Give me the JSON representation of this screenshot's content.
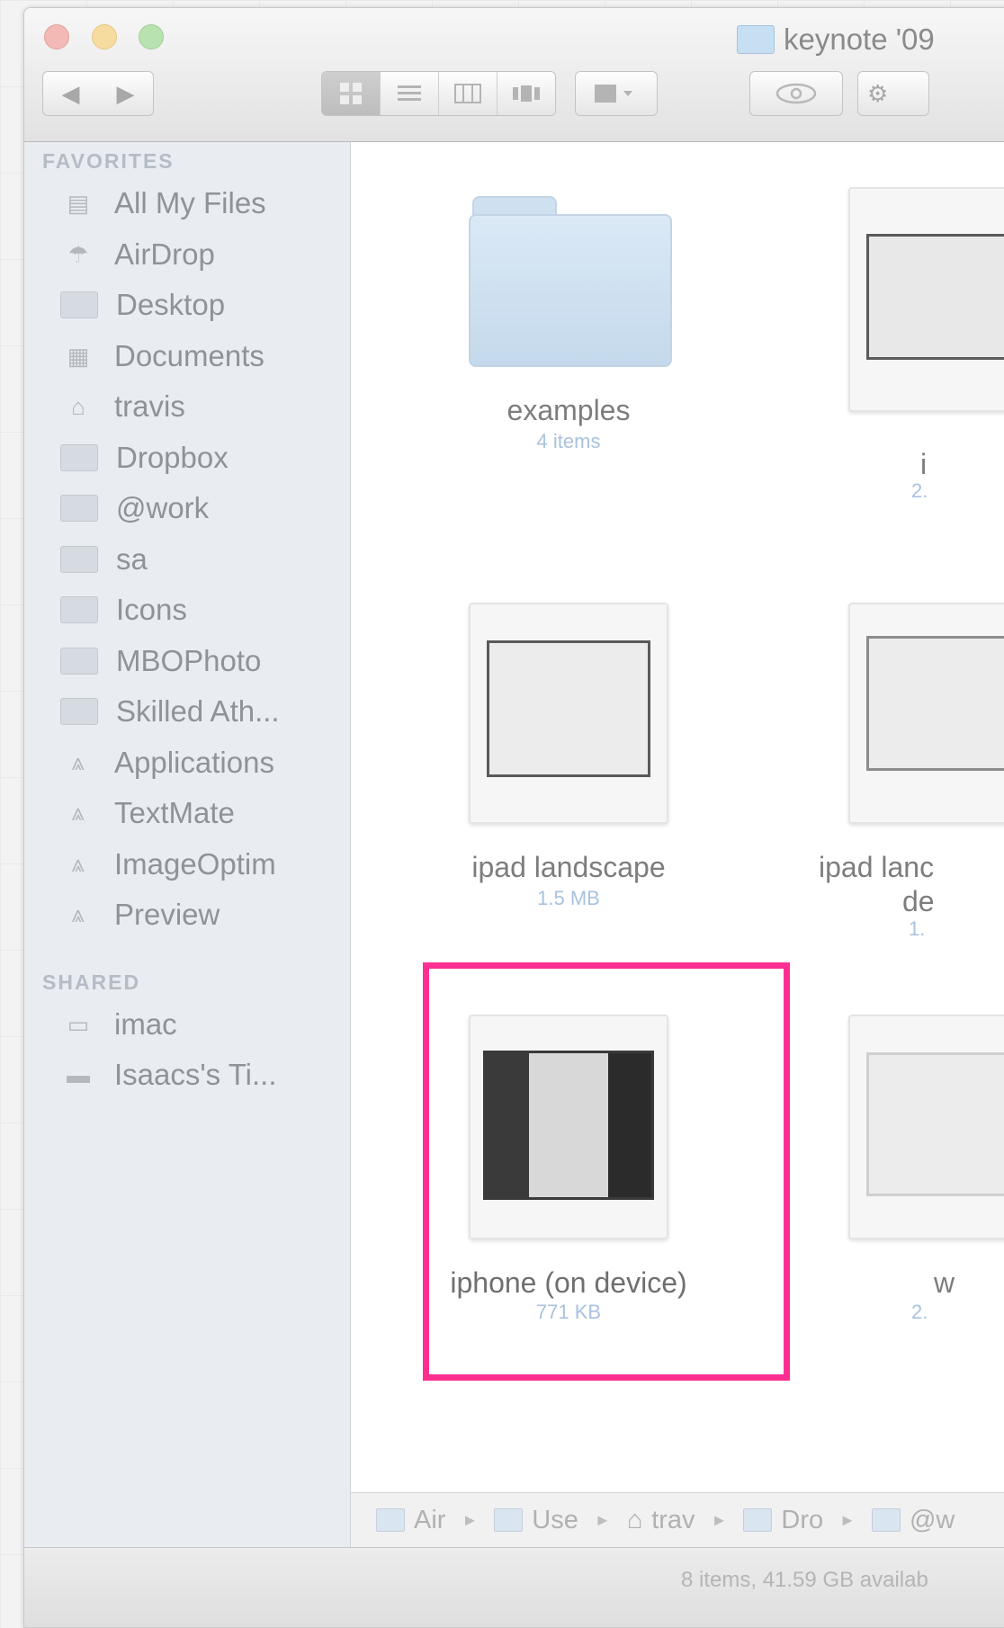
{
  "window": {
    "title": "keynote '09"
  },
  "toolbar": {
    "back": "◀",
    "forward": "▶",
    "views": [
      "icon-view",
      "list-view",
      "column-view",
      "coverflow-view"
    ],
    "arrange": "arrange-menu",
    "quicklook": "quicklook",
    "action": "action-menu"
  },
  "sidebar": {
    "favorites_heading": "FAVORITES",
    "favorites": [
      {
        "label": "All My Files",
        "icon": "all-files-icon"
      },
      {
        "label": "AirDrop",
        "icon": "airdrop-icon"
      },
      {
        "label": "Desktop",
        "icon": "desktop-icon"
      },
      {
        "label": "Documents",
        "icon": "documents-icon"
      },
      {
        "label": "travis",
        "icon": "home-icon"
      },
      {
        "label": "Dropbox",
        "icon": "folder-icon"
      },
      {
        "label": "@work",
        "icon": "folder-icon"
      },
      {
        "label": "sa",
        "icon": "folder-icon"
      },
      {
        "label": "Icons",
        "icon": "folder-icon"
      },
      {
        "label": "MBOPhoto",
        "icon": "folder-icon"
      },
      {
        "label": "Skilled Ath...",
        "icon": "folder-icon"
      },
      {
        "label": "Applications",
        "icon": "applications-icon"
      },
      {
        "label": "TextMate",
        "icon": "applications-icon"
      },
      {
        "label": "ImageOptim",
        "icon": "applications-icon"
      },
      {
        "label": "Preview",
        "icon": "applications-icon"
      }
    ],
    "shared_heading": "SHARED",
    "shared": [
      {
        "label": "imac",
        "icon": "display-icon"
      },
      {
        "label": "Isaacs's Ti...",
        "icon": "server-icon"
      }
    ]
  },
  "files": [
    {
      "name": "examples",
      "sub": "4 items",
      "kind": "folder"
    },
    {
      "name": "i",
      "sub": "2.",
      "kind": "keynote"
    },
    {
      "name": "ipad landscape",
      "sub": "1.5 MB",
      "kind": "keynote"
    },
    {
      "name": "ipad lanc",
      "name2": "de",
      "sub": "1.",
      "kind": "keynote"
    },
    {
      "name": "iphone (on device)",
      "sub": "771 KB",
      "kind": "keynote"
    },
    {
      "name": "w",
      "sub": "2.",
      "kind": "keynote"
    }
  ],
  "pathbar": [
    {
      "label": "Air"
    },
    {
      "label": "Use"
    },
    {
      "label": "trav"
    },
    {
      "label": "Dro"
    },
    {
      "label": "@w"
    }
  ],
  "status": {
    "text": "8 items, 41.59 GB availab"
  },
  "highlight_color": "#ff2f92"
}
